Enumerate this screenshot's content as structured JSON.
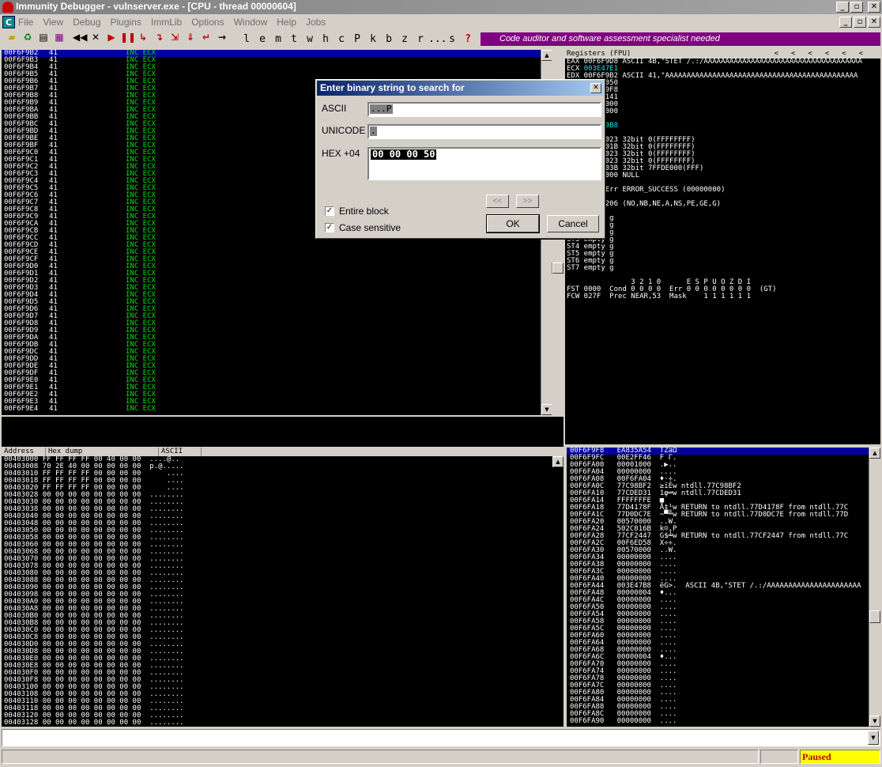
{
  "window": {
    "title": "Immunity Debugger - vulnserver.exe - [CPU - thread 00000604]"
  },
  "menu": [
    "File",
    "View",
    "Debug",
    "Plugins",
    "ImmLib",
    "Options",
    "Window",
    "Help",
    "Jobs"
  ],
  "toolbar": {
    "letters": [
      "l",
      "e",
      "m",
      "t",
      "w",
      "h",
      "c",
      "P",
      "k",
      "b",
      "z",
      "r",
      "...",
      "s",
      "?"
    ],
    "banner": "Code auditor and software assessment specialist needed"
  },
  "cpu": {
    "rows": [
      {
        "addr": "00F6F9B2",
        "hex": "41",
        "asm": "INC ECX"
      },
      {
        "addr": "00F6F9B3",
        "hex": "41",
        "asm": "INC ECX"
      },
      {
        "addr": "00F6F9B4",
        "hex": "41",
        "asm": "INC ECX"
      },
      {
        "addr": "00F6F9B5",
        "hex": "41",
        "asm": "INC ECX"
      },
      {
        "addr": "00F6F9B6",
        "hex": "41",
        "asm": "INC ECX"
      },
      {
        "addr": "00F6F9B7",
        "hex": "41",
        "asm": "INC ECX"
      },
      {
        "addr": "00F6F9B8",
        "hex": "41",
        "asm": "INC ECX"
      },
      {
        "addr": "00F6F9B9",
        "hex": "41",
        "asm": "INC ECX"
      },
      {
        "addr": "00F6F9BA",
        "hex": "41",
        "asm": "INC ECX"
      },
      {
        "addr": "00F6F9BB",
        "hex": "41",
        "asm": "INC ECX"
      },
      {
        "addr": "00F6F9BC",
        "hex": "41",
        "asm": "INC ECX"
      },
      {
        "addr": "00F6F9BD",
        "hex": "41",
        "asm": "INC ECX"
      },
      {
        "addr": "00F6F9BE",
        "hex": "41",
        "asm": "INC ECX"
      },
      {
        "addr": "00F6F9BF",
        "hex": "41",
        "asm": "INC ECX"
      },
      {
        "addr": "00F6F9C0",
        "hex": "41",
        "asm": "INC ECX"
      },
      {
        "addr": "00F6F9C1",
        "hex": "41",
        "asm": "INC ECX"
      },
      {
        "addr": "00F6F9C2",
        "hex": "41",
        "asm": "INC ECX"
      },
      {
        "addr": "00F6F9C3",
        "hex": "41",
        "asm": "INC ECX"
      },
      {
        "addr": "00F6F9C4",
        "hex": "41",
        "asm": "INC ECX"
      },
      {
        "addr": "00F6F9C5",
        "hex": "41",
        "asm": "INC ECX"
      },
      {
        "addr": "00F6F9C6",
        "hex": "41",
        "asm": "INC ECX"
      },
      {
        "addr": "00F6F9C7",
        "hex": "41",
        "asm": "INC ECX"
      },
      {
        "addr": "00F6F9C8",
        "hex": "41",
        "asm": "INC ECX"
      },
      {
        "addr": "00F6F9C9",
        "hex": "41",
        "asm": "INC ECX"
      },
      {
        "addr": "00F6F9CA",
        "hex": "41",
        "asm": "INC ECX"
      },
      {
        "addr": "00F6F9CB",
        "hex": "41",
        "asm": "INC ECX"
      },
      {
        "addr": "00F6F9CC",
        "hex": "41",
        "asm": "INC ECX"
      },
      {
        "addr": "00F6F9CD",
        "hex": "41",
        "asm": "INC ECX"
      },
      {
        "addr": "00F6F9CE",
        "hex": "41",
        "asm": "INC ECX"
      },
      {
        "addr": "00F6F9CF",
        "hex": "41",
        "asm": "INC ECX"
      },
      {
        "addr": "00F6F9D0",
        "hex": "41",
        "asm": "INC ECX"
      },
      {
        "addr": "00F6F9D1",
        "hex": "41",
        "asm": "INC ECX"
      },
      {
        "addr": "00F6F9D2",
        "hex": "41",
        "asm": "INC ECX"
      },
      {
        "addr": "00F6F9D3",
        "hex": "41",
        "asm": "INC ECX"
      },
      {
        "addr": "00F6F9D4",
        "hex": "41",
        "asm": "INC ECX"
      },
      {
        "addr": "00F6F9D5",
        "hex": "41",
        "asm": "INC ECX"
      },
      {
        "addr": "00F6F9D6",
        "hex": "41",
        "asm": "INC ECX"
      },
      {
        "addr": "00F6F9D7",
        "hex": "41",
        "asm": "INC ECX"
      },
      {
        "addr": "00F6F9D8",
        "hex": "41",
        "asm": "INC ECX"
      },
      {
        "addr": "00F6F9D9",
        "hex": "41",
        "asm": "INC ECX"
      },
      {
        "addr": "00F6F9DA",
        "hex": "41",
        "asm": "INC ECX"
      },
      {
        "addr": "00F6F9DB",
        "hex": "41",
        "asm": "INC ECX"
      },
      {
        "addr": "00F6F9DC",
        "hex": "41",
        "asm": "INC ECX"
      },
      {
        "addr": "00F6F9DD",
        "hex": "41",
        "asm": "INC ECX"
      },
      {
        "addr": "00F6F9DE",
        "hex": "41",
        "asm": "INC ECX"
      },
      {
        "addr": "00F6F9DF",
        "hex": "41",
        "asm": "INC ECX"
      },
      {
        "addr": "00F6F9E0",
        "hex": "41",
        "asm": "INC ECX"
      },
      {
        "addr": "00F6F9E1",
        "hex": "41",
        "asm": "INC ECX"
      },
      {
        "addr": "00F6F9E2",
        "hex": "41",
        "asm": "INC ECX"
      },
      {
        "addr": "00F6F9E3",
        "hex": "41",
        "asm": "INC ECX"
      },
      {
        "addr": "00F6F9E4",
        "hex": "41",
        "asm": "INC ECX"
      }
    ]
  },
  "registers": {
    "header": "Registers (FPU)",
    "nav": [
      "<",
      "<",
      "<",
      "<",
      "<",
      "<"
    ],
    "lines": [
      {
        "t": "EAX 00F6F9D8 ASCII 4B,\"STET /.:/AAAAAAAAAAAAAAAAAAAAAAAAAAAAAAAAAAAAA"
      },
      {
        "t": "ECX ",
        "c": "003E47E1"
      },
      {
        "t": "EDX 00F6F9B2 ASCII 41,\"AAAAAAAAAAAAAAAAAAAAAAAAAAAAAAAAAAAAAAAAAAAAA"
      },
      {
        "t": "EBX 00000050"
      },
      {
        "t": "ESP 00F6F9F8"
      },
      {
        "t": "EBP 41414141"
      },
      {
        "t": "ESI 00000000"
      },
      {
        "t": "EDI 00000000"
      },
      {
        "t": ""
      },
      {
        "t": "EIP ",
        "c": "00F6F9B8"
      },
      {
        "t": ""
      },
      {
        "t": "C 0  ES 0023 32bit 0(FFFFFFFF)"
      },
      {
        "t": "P 1  CS 001B 32bit 0(FFFFFFFF)"
      },
      {
        "t": "A 0  SS 0023 32bit 0(FFFFFFFF)"
      },
      {
        "t": "Z 1  DS 0023 32bit 0(FFFFFFFF)"
      },
      {
        "t": "S 0  FS 003B 32bit 7FFDE000(FFF)"
      },
      {
        "t": "T 0  GS 0000 NULL"
      },
      {
        "t": "D 0"
      },
      {
        "t": "O 0  LastErr ERROR_SUCCESS (00000000)"
      },
      {
        "t": ""
      },
      {
        "t": "EFL 00000206 (NO,NB,NE,A,NS,PE,GE,G)"
      },
      {
        "t": ""
      },
      {
        "t": "ST0 empty g"
      },
      {
        "t": "ST1 empty g"
      },
      {
        "t": "ST2 empty g"
      },
      {
        "t": "ST3 empty g"
      },
      {
        "t": "ST4 empty g"
      },
      {
        "t": "ST5 empty g"
      },
      {
        "t": "ST6 empty g"
      },
      {
        "t": "ST7 empty g"
      },
      {
        "t": ""
      },
      {
        "t": "               3 2 1 0      E S P U O Z D I"
      },
      {
        "t": "FST 0000  Cond 0 0 0 0  Err 0 0 0 0 0 0 0 0  (GT)"
      },
      {
        "t": "FCW 027F  Prec NEAR,53  Mask    1 1 1 1 1 1"
      }
    ]
  },
  "dump": {
    "headers": [
      "Address",
      "Hex dump",
      "ASCII"
    ],
    "rows": [
      "00403000 FF FF FF FF 00 40 00 00  ....@..",
      "00403008 70 2E 40 00 00 00 00 00  p.@.....",
      "00403010 FF FF FF FF 00 00 00 00      ....",
      "00403018 FF FF FF FF 00 00 00 00      ....",
      "00403020 FF FF FF FF 00 00 00 00      ....",
      "00403028 00 00 00 00 00 00 00 00  ........",
      "00403030 00 00 00 00 00 00 00 00  ........",
      "00403038 00 00 00 00 00 00 00 00  ........",
      "00403040 00 00 00 00 00 00 00 00  ........",
      "00403048 00 00 00 00 00 00 00 00  ........",
      "00403050 00 00 00 00 00 00 00 00  ........",
      "00403058 00 00 00 00 00 00 00 00  ........",
      "00403060 00 00 00 00 00 00 00 00  ........",
      "00403068 00 00 00 00 00 00 00 00  ........",
      "00403070 00 00 00 00 00 00 00 00  ........",
      "00403078 00 00 00 00 00 00 00 00  ........",
      "00403080 00 00 00 00 00 00 00 00  ........",
      "00403088 00 00 00 00 00 00 00 00  ........",
      "00403090 00 00 00 00 00 00 00 00  ........",
      "00403098 00 00 00 00 00 00 00 00  ........",
      "004030A0 00 00 00 00 00 00 00 00  ........",
      "004030A8 00 00 00 00 00 00 00 00  ........",
      "004030B0 00 00 00 00 00 00 00 00  ........",
      "004030B8 00 00 00 00 00 00 00 00  ........",
      "004030C0 00 00 00 00 00 00 00 00  ........",
      "004030C8 00 00 00 00 00 00 00 00  ........",
      "004030D0 00 00 00 00 00 00 00 00  ........",
      "004030D8 00 00 00 00 00 00 00 00  ........",
      "004030E0 00 00 00 00 00 00 00 00  ........",
      "004030E8 00 00 00 00 00 00 00 00  ........",
      "004030F0 00 00 00 00 00 00 00 00  ........",
      "004030F8 00 00 00 00 00 00 00 00  ........",
      "00403100 00 00 00 00 00 00 00 00  ........",
      "00403108 00 00 00 00 00 00 00 00  ........",
      "00403110 00 00 00 00 00 00 00 00  ........",
      "00403118 00 00 00 00 00 00 00 00  ........",
      "00403120 00 00 00 00 00 00 00 00  ........",
      "00403128 00 00 00 00 00 00 00 00  ........"
    ]
  },
  "stack": {
    "rows": [
      "00F6F9F8   EA835A54  TZâΩ",
      "00F6F9FC   00E2FF46  F Γ.",
      "00F6FA00   00001000  .▶..",
      "00F6FA04   00000000  ....",
      "00F6FA08   00F6FA04  ♦·÷.",
      "00F6FA0C   77C98BF2  ≥ïÉw ntdll.77C98BF2",
      "00F6FA10   77CDED31  1φ═w ntdll.77CDED31",
      "00F6FA14   FFFFFFFE  ■",
      "00F6FA18   77D4178F  Å‡¹w RETURN to ntdll.77D4178F from ntdll.77C",
      "00F6FA1C   77D0DC7E  ~▀╨w RETURN to ntdll.77D0DC7E from ntdll.77D",
      "00F6FA20   00570000  ..W.",
      "00F6FA24   502C016B  k☺,P",
      "00F6FA28   77CF2447  G$╧w RETURN to ntdll.77CF2447 from ntdll.77C",
      "00F6FA2C   00F6ED58  X÷÷.",
      "00F6FA30   00570000  ..W.",
      "00F6FA34   00000000  ....",
      "00F6FA38   00000000  ....",
      "00F6FA3C   00000000  ....",
      "00F6FA40   00000000  ....",
      "00F6FA44   003E47B8  ëG>.  ASCII 4B,\"STET /.:/AAAAAAAAAAAAAAAAAAAAAA",
      "00F6FA48   00000004  ♦...",
      "00F6FA4C   00000000  ....",
      "00F6FA50   00000000  ....",
      "00F6FA54   00000000  ....",
      "00F6FA58   00000000  ....",
      "00F6FA5C   00000000  ....",
      "00F6FA60   00000000  ....",
      "00F6FA64   00000000  ....",
      "00F6FA68   00000000  ....",
      "00F6FA6C   00000004  ♦...",
      "00F6FA70   00000000  ....",
      "00F6FA74   00000000  ....",
      "00F6FA78   00000000  ....",
      "00F6FA7C   00000000  ....",
      "00F6FA80   00000000  ....",
      "00F6FA84   00000000  ....",
      "00F6FA88   00000000  ....",
      "00F6FA8C   00000000  ....",
      "00F6FA90   00000000  ...."
    ]
  },
  "dialog": {
    "title": "Enter binary string to search for",
    "ascii_label": "ASCII",
    "ascii_value": "...P",
    "unicode_label": "UNICODE",
    "unicode_value": ".",
    "hex_label": "HEX +04",
    "hex_value": "00 00 00 50",
    "prev_label": "<<",
    "next_label": ">>",
    "entire_block_label": "Entire block",
    "case_sensitive_label": "Case sensitive",
    "ok_label": "OK",
    "cancel_label": "Cancel"
  },
  "status": {
    "state": "Paused"
  }
}
